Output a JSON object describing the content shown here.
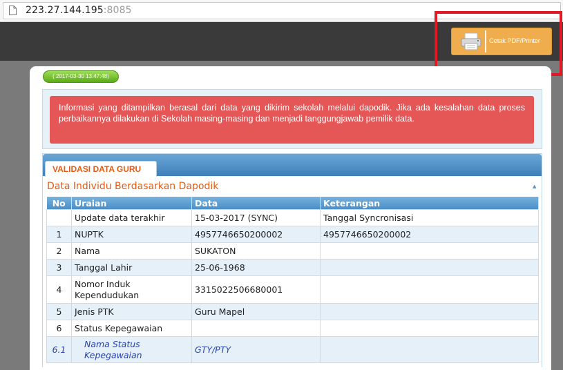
{
  "browser": {
    "url_host": "223.27.144.195",
    "url_port": ":8085"
  },
  "header": {
    "print_button_label": "Cetak PDF/Printer"
  },
  "timestamp_badge": "( 2017-03-30 13:47:48)",
  "alert_text": "Informasi yang ditampilkan berasal dari data yang dikirim sekolah melalui dapodik. Jika ada kesalahan data proses perbaikannya dilakukan di Sekolah masing-masing dan menjadi tanggungjawab pemilik data.",
  "tab_label": "VALIDASI DATA GURU",
  "section_title": "Data Individu Berdasarkan Dapodik",
  "table": {
    "headers": {
      "no": "No",
      "uraian": "Uraian",
      "data": "Data",
      "keterangan": "Keterangan"
    },
    "rows": [
      {
        "no": "",
        "uraian": "Update data terakhir",
        "data": "15-03-2017 (SYNC)",
        "keterangan": "Tanggal Syncronisasi"
      },
      {
        "no": "1",
        "uraian": "NUPTK",
        "data": "4957746650200002",
        "keterangan": "4957746650200002"
      },
      {
        "no": "2",
        "uraian": "Nama",
        "data": "SUKATON",
        "keterangan": ""
      },
      {
        "no": "3",
        "uraian": "Tanggal Lahir",
        "data": "25-06-1968",
        "keterangan": ""
      },
      {
        "no": "4",
        "uraian": "Nomor Induk Kependudukan",
        "data": "3315022506680001",
        "keterangan": ""
      },
      {
        "no": "5",
        "uraian": "Jenis PTK",
        "data": "Guru Mapel",
        "keterangan": ""
      },
      {
        "no": "6",
        "uraian": "Status Kepegawaian",
        "data": "",
        "keterangan": ""
      },
      {
        "no": "6.1",
        "uraian": "Nama Status Kepegawaian",
        "data": "GTY/PTY",
        "keterangan": ""
      }
    ]
  },
  "colors": {
    "alert_red": "#e55757",
    "accent_orange": "#e45b13",
    "button_orange": "#f0ad4e",
    "header_blue": "#4b8ec7",
    "highlight_red": "#e01b24"
  }
}
